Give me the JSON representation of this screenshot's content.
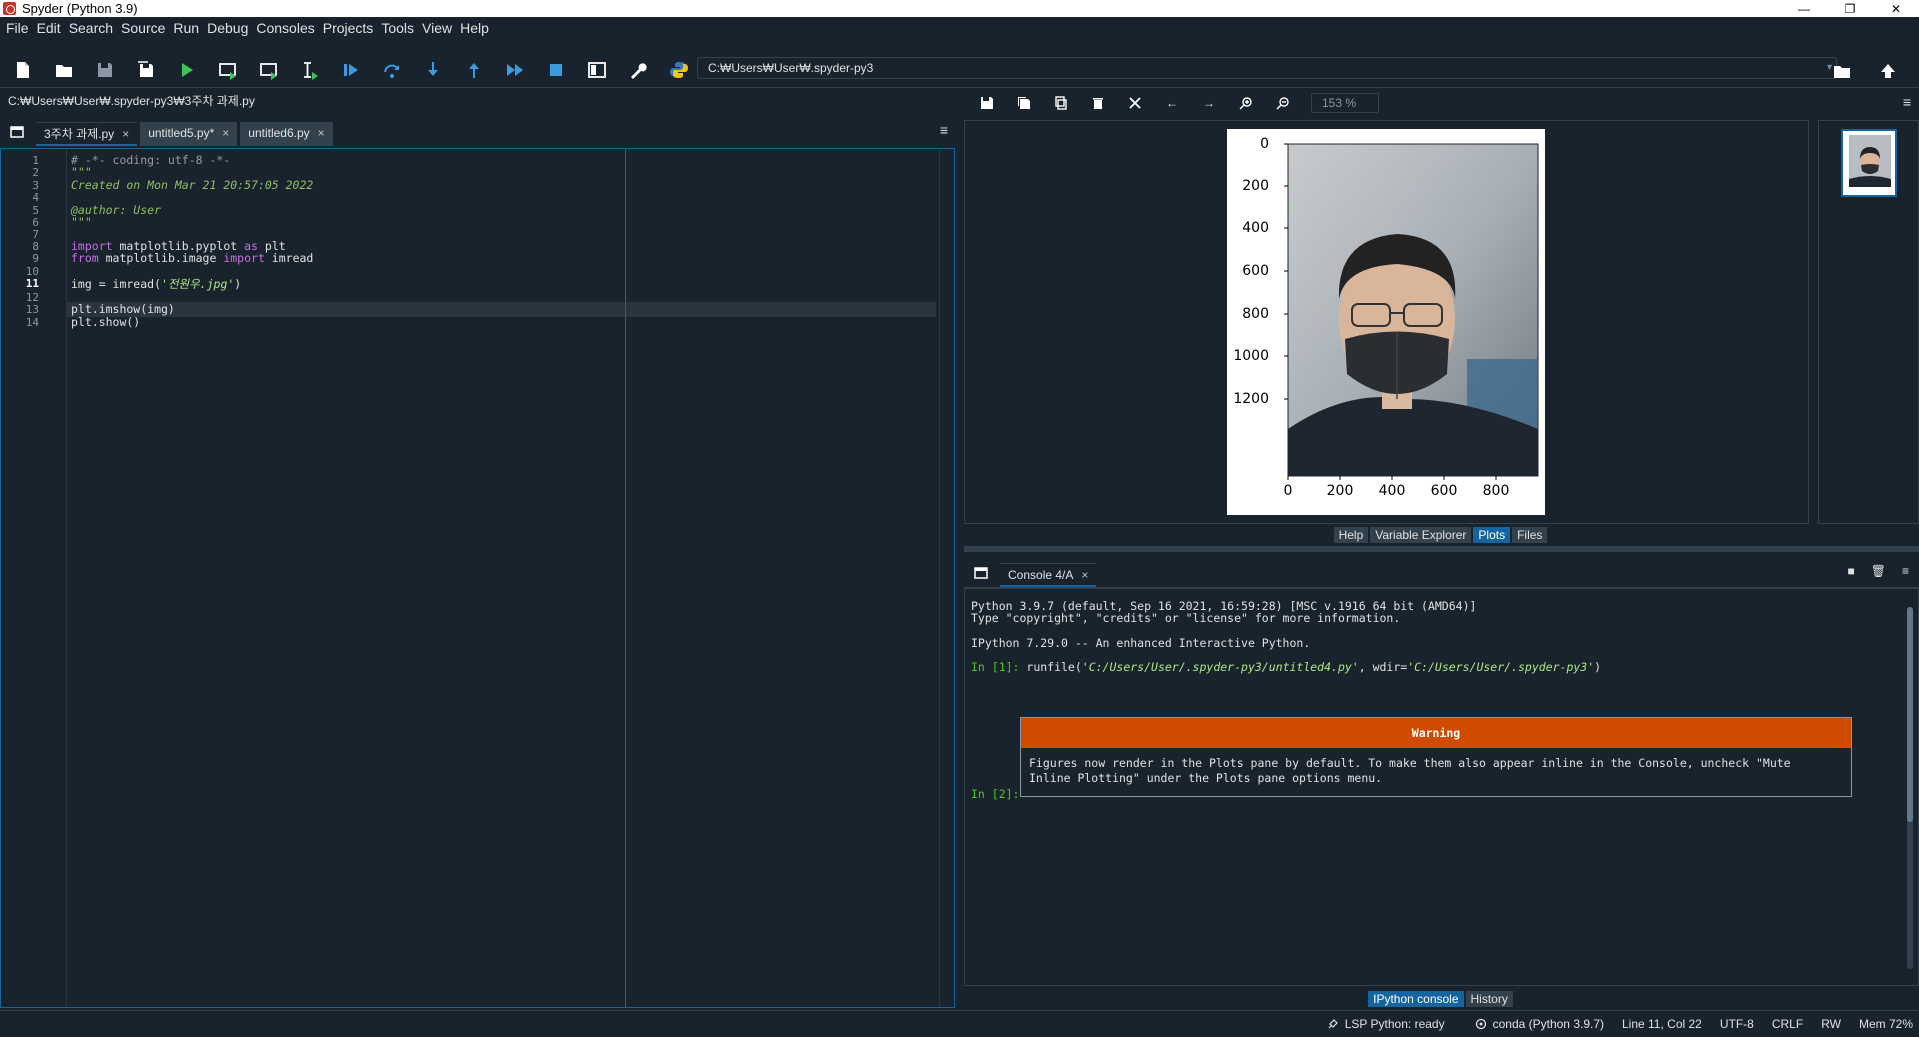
{
  "window": {
    "title": "Spyder (Python 3.9)"
  },
  "menu": [
    "File",
    "Edit",
    "Search",
    "Source",
    "Run",
    "Debug",
    "Consoles",
    "Projects",
    "Tools",
    "View",
    "Help"
  ],
  "toolbar": {
    "working_dir": "C:₩Users₩User₩.spyder-py3"
  },
  "editor": {
    "file_path": "C:₩Users₩User₩.spyder-py3₩3주차 과제.py",
    "tabs": [
      {
        "label": "3주차 과제.py",
        "active": true
      },
      {
        "label": "untitled5.py*",
        "active": false
      },
      {
        "label": "untitled6.py",
        "active": false
      }
    ],
    "current_line": 11,
    "lines": [
      "# -*- coding: utf-8 -*-",
      "\"\"\"",
      "Created on Mon Mar 21 20:57:05 2022",
      "",
      "@author: User",
      "\"\"\"",
      "",
      "import matplotlib.pyplot as plt",
      "from matplotlib.image import imread",
      "",
      "img = imread('전원우.jpg')",
      "",
      "plt.imshow(img)",
      "plt.show()"
    ],
    "code": {
      "l1": "# -*- coding: utf-8 -*-",
      "l2": "\"\"\"",
      "l3": "Created on Mon Mar 21 20:57:05 2022",
      "l5": "@author: User",
      "l6": "\"\"\"",
      "l8_kw1": "import",
      "l8_mod": " matplotlib.pyplot ",
      "l8_kw2": "as",
      "l8_alias": " plt",
      "l9_kw1": "from",
      "l9_mod": " matplotlib.image ",
      "l9_kw2": "import",
      "l9_name": " imread",
      "l11_pre": "img = imread(",
      "l11_str": "'전원우.jpg'",
      "l11_post": ")",
      "l13": "plt.imshow(img)",
      "l14": "plt.show()"
    }
  },
  "plots": {
    "zoom": "153 %",
    "tabs": [
      {
        "label": "Help",
        "active": false
      },
      {
        "label": "Variable Explorer",
        "active": false
      },
      {
        "label": "Plots",
        "active": true
      },
      {
        "label": "Files",
        "active": false
      }
    ],
    "figure": {
      "y_ticks": [
        "0",
        "200",
        "400",
        "600",
        "800",
        "1000",
        "1200"
      ],
      "x_ticks": [
        "0",
        "200",
        "400",
        "600",
        "800"
      ]
    }
  },
  "console": {
    "tab_label": "Console 4/A",
    "banner1": "Python 3.9.7 (default, Sep 16 2021, 16:59:28) [MSC v.1916 64 bit (AMD64)]",
    "banner2": "Type \"copyright\", \"credits\" or \"license\" for more information.",
    "banner3": "IPython 7.29.0 -- An enhanced Interactive Python.",
    "in1_prompt": "In [1]:",
    "in1_pre": " runfile(",
    "in1_path1": "'C:/Users/User/.spyder-py3/untitled4.py'",
    "in1_mid": ", wdir=",
    "in1_path2": "'C:/Users/User/.spyder-py3'",
    "in1_post": ")",
    "warning_title": "Warning",
    "warning_body": "Figures now render in the Plots pane by default. To make them also appear inline in the Console, uncheck \"Mute\nInline Plotting\" under the Plots pane options menu.",
    "in2_prompt": "In [2]:",
    "bottom_tabs": [
      {
        "label": "IPython console",
        "active": true
      },
      {
        "label": "History",
        "active": false
      }
    ]
  },
  "status": {
    "lsp": "LSP Python: ready",
    "env": "conda (Python 3.9.7)",
    "cursor": "Line 11, Col 22",
    "encoding": "UTF-8",
    "eol": "CRLF",
    "rw": "RW",
    "mem": "Mem 72%"
  },
  "colors": {
    "accent": "#1464a0",
    "warning": "#d04a02",
    "background": "#19232d"
  }
}
